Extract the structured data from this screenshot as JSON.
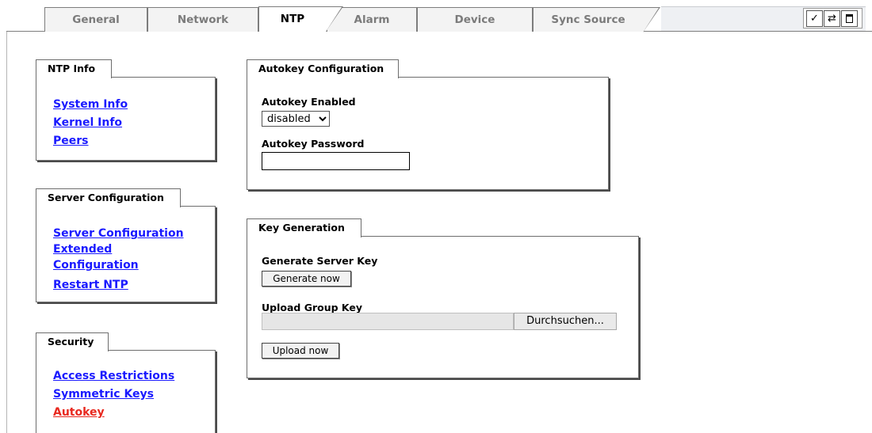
{
  "tabs": [
    {
      "label": "General"
    },
    {
      "label": "Network"
    },
    {
      "label": "NTP"
    },
    {
      "label": "Alarm"
    },
    {
      "label": "Device"
    },
    {
      "label": "Sync Source"
    }
  ],
  "active_tab": "NTP",
  "toolbar": {
    "icons": [
      "check-icon",
      "swap-icon",
      "document-icon"
    ]
  },
  "ntp_info": {
    "title": "NTP Info",
    "links": [
      "System Info",
      "Kernel Info",
      "Peers"
    ]
  },
  "server_config": {
    "title": "Server Configuration",
    "links": [
      "Server Configuration",
      "Extended",
      "Configuration",
      "Restart NTP"
    ]
  },
  "security": {
    "title": "Security",
    "links": [
      "Access Restrictions",
      "Symmetric Keys",
      "Autokey"
    ],
    "current": "Autokey"
  },
  "autokey_config": {
    "title": "Autokey Configuration",
    "enabled_label": "Autokey Enabled",
    "enabled_value": "disabled",
    "password_label": "Autokey Password",
    "password_value": ""
  },
  "key_generation": {
    "title": "Key Generation",
    "server_key_label": "Generate Server Key",
    "generate_button": "Generate now",
    "upload_label": "Upload Group Key",
    "browse_button": "Durchsuchen...",
    "upload_button": "Upload now"
  },
  "colors": {
    "link": "#1a1aff",
    "current_link": "#e8281e"
  }
}
